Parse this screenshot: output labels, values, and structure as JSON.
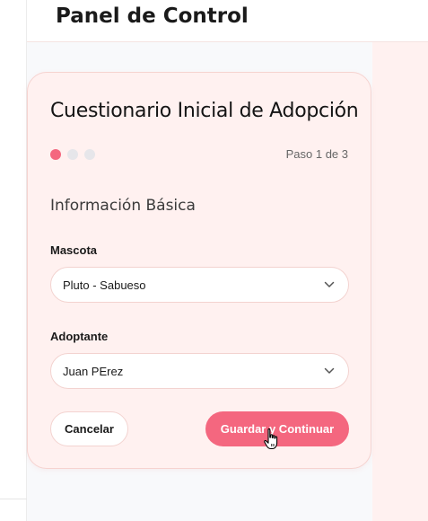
{
  "header": {
    "title": "Panel de Control"
  },
  "form": {
    "title": "Cuestionario Inicial de Adopción",
    "step_text": "Paso 1 de 3",
    "steps_total": 3,
    "current_step": 1,
    "section_title": "Información Básica",
    "pet": {
      "label": "Mascota",
      "value": "Pluto - Sabueso"
    },
    "adopter": {
      "label": "Adoptante",
      "value": "Juan PErez"
    },
    "cancel_label": "Cancelar",
    "submit_label": "Guardar y Continuar"
  },
  "colors": {
    "accent": "#f4677f",
    "card_bg": "#fff1f0"
  },
  "icons": {
    "select_chevron": "chevron-down-icon",
    "cursor": "hand-pointer-cursor"
  }
}
